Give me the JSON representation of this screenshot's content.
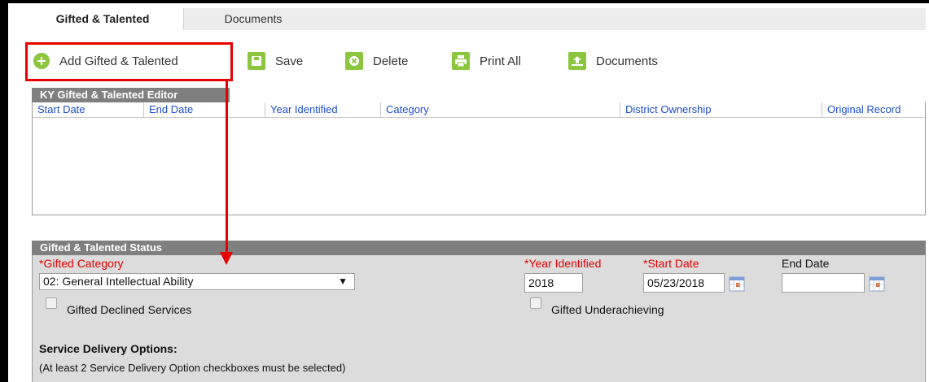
{
  "tabs": [
    {
      "label": "Gifted & Talented",
      "active": true
    },
    {
      "label": "Documents",
      "active": false
    }
  ],
  "toolbar": {
    "add_label": "Add Gifted & Talented",
    "save_label": "Save",
    "delete_label": "Delete",
    "print_label": "Print All",
    "documents_label": "Documents"
  },
  "editor": {
    "title": "KY Gifted & Talented Editor",
    "columns": [
      "Start Date",
      "End Date",
      "Year Identified",
      "Category",
      "District Ownership",
      "Original Record"
    ]
  },
  "status": {
    "title": "Gifted & Talented Status",
    "gifted_category_label": "*Gifted Category",
    "gifted_category_value": "02: General Intellectual Ability",
    "year_identified_label": "*Year Identified",
    "year_identified_value": "2018",
    "start_date_label": "*Start Date",
    "start_date_value": "05/23/2018",
    "end_date_label": "End Date",
    "end_date_value": "",
    "declined_label": "Gifted Declined Services",
    "underachieving_label": "Gifted Underachieving",
    "service_options_heading": "Service Delivery Options:",
    "service_options_note": "(At least 2 Service Delivery Option checkboxes must be selected)"
  },
  "colors": {
    "accent_green": "#8cc63f",
    "required_red": "#e60000",
    "link_blue": "#1e4fd2",
    "header_gray": "#7f7f7f"
  }
}
